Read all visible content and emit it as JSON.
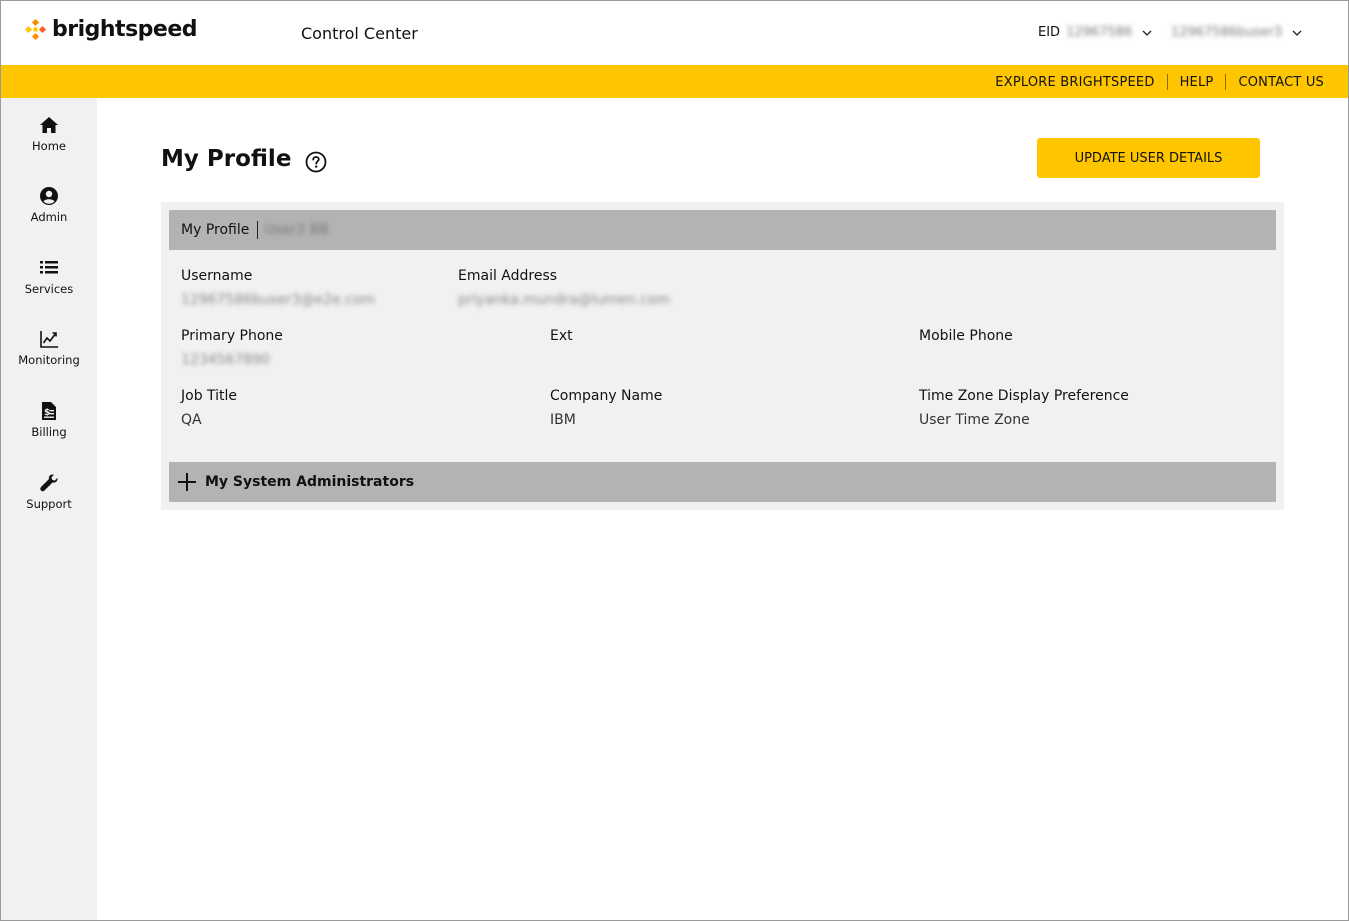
{
  "brand": {
    "name": "brightspeed",
    "accent": "#ffc600"
  },
  "header": {
    "app_title": "Control Center",
    "eid_label": "EID",
    "eid_value": "12967586",
    "user_name": "12967586buser3"
  },
  "utility_links": [
    "EXPLORE BRIGHTSPEED",
    "HELP",
    "CONTACT US"
  ],
  "sidebar": {
    "items": [
      {
        "label": "Home",
        "icon": "home-icon"
      },
      {
        "label": "Admin",
        "icon": "user-circle-icon"
      },
      {
        "label": "Services",
        "icon": "list-icon"
      },
      {
        "label": "Monitoring",
        "icon": "chart-line-icon"
      },
      {
        "label": "Billing",
        "icon": "invoice-icon"
      },
      {
        "label": "Support",
        "icon": "wrench-icon"
      }
    ]
  },
  "main": {
    "title": "My Profile",
    "update_button": "UPDATE USER DETAILS",
    "panel": {
      "title": "My Profile",
      "user_display_name": "User3 BB",
      "fields": {
        "username": {
          "label": "Username",
          "value": "12967586buser3@e2e.com"
        },
        "email": {
          "label": "Email Address",
          "value": "priyanka.mundra@lumen.com"
        },
        "primary_phone": {
          "label": "Primary Phone",
          "value": "1234567890"
        },
        "ext": {
          "label": "Ext",
          "value": ""
        },
        "mobile_phone": {
          "label": "Mobile Phone",
          "value": ""
        },
        "job_title": {
          "label": "Job Title",
          "value": "QA"
        },
        "company_name": {
          "label": "Company Name",
          "value": "IBM"
        },
        "time_zone": {
          "label": "Time Zone Display Preference",
          "value": "User Time Zone"
        }
      },
      "admins_section": "My System Administrators"
    }
  }
}
